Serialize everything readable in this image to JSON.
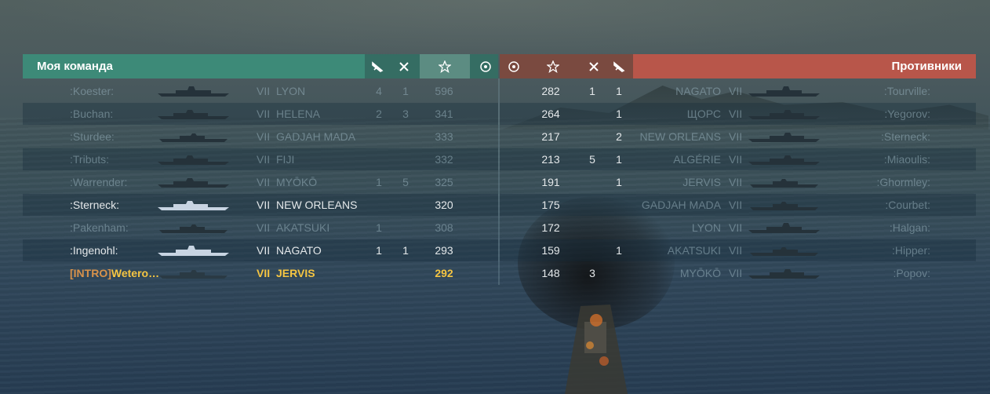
{
  "header": {
    "my_team_title": "Моя команда",
    "enemy_team_title": "Противники",
    "left_icons": [
      "plane-icon",
      "ship-kill-icon",
      "star-icon",
      "laurel-icon"
    ],
    "right_icons": [
      "laurel-icon",
      "star-icon",
      "ship-kill-icon",
      "plane-icon"
    ]
  },
  "colors": {
    "my_team_header": "#3d8a78",
    "enemy_header": "#b8564a",
    "self_highlight": "#f5c542",
    "clan_tag": "#d8924a"
  },
  "my_team": [
    {
      "player": ":Koester:",
      "tier": "VII",
      "ship": "LYON",
      "kills": "4",
      "planes": "1",
      "score": "596",
      "alive": false,
      "ship_icon": "battleship-icon"
    },
    {
      "player": ":Buchan:",
      "tier": "VII",
      "ship": "HELENA",
      "kills": "2",
      "planes": "3",
      "score": "341",
      "alive": false,
      "ship_icon": "cruiser-icon"
    },
    {
      "player": ":Sturdee:",
      "tier": "VII",
      "ship": "GADJAH MADA",
      "kills": "",
      "planes": "",
      "score": "333",
      "alive": false,
      "ship_icon": "destroyer-icon"
    },
    {
      "player": ":Tributs:",
      "tier": "VII",
      "ship": "FIJI",
      "kills": "",
      "planes": "",
      "score": "332",
      "alive": false,
      "ship_icon": "cruiser-icon"
    },
    {
      "player": ":Warrender:",
      "tier": "VII",
      "ship": "MYŌKŌ",
      "kills": "1",
      "planes": "5",
      "score": "325",
      "alive": false,
      "ship_icon": "cruiser-icon"
    },
    {
      "player": ":Sterneck:",
      "tier": "VII",
      "ship": "NEW ORLEANS",
      "kills": "",
      "planes": "",
      "score": "320",
      "alive": true,
      "ship_icon": "cruiser-icon"
    },
    {
      "player": ":Pakenham:",
      "tier": "VII",
      "ship": "AKATSUKI",
      "kills": "1",
      "planes": "",
      "score": "308",
      "alive": false,
      "ship_icon": "destroyer-icon"
    },
    {
      "player": ":Ingenohl:",
      "tier": "VII",
      "ship": "NAGATO",
      "kills": "1",
      "planes": "1",
      "score": "293",
      "alive": true,
      "ship_icon": "battleship-icon"
    },
    {
      "clan": "[INTRO]",
      "player": "Wetero…",
      "tier": "VII",
      "ship": "JERVIS",
      "kills": "",
      "planes": "",
      "score": "292",
      "alive": false,
      "self": true,
      "ship_icon": "destroyer-icon"
    }
  ],
  "enemy_team": [
    {
      "score": "282",
      "planes": "1",
      "kills": "1",
      "ship": "NAGATO",
      "tier": "VII",
      "player": ":Tourville:",
      "ship_icon": "battleship-icon"
    },
    {
      "score": "264",
      "planes": "",
      "kills": "1",
      "ship": "ЩОРС",
      "tier": "VII",
      "player": ":Yegorov:",
      "ship_icon": "cruiser-icon"
    },
    {
      "score": "217",
      "planes": "",
      "kills": "2",
      "ship": "NEW ORLEANS",
      "tier": "VII",
      "player": ":Sterneck:",
      "ship_icon": "cruiser-icon"
    },
    {
      "score": "213",
      "planes": "5",
      "kills": "1",
      "ship": "ALGÉRIE",
      "tier": "VII",
      "player": ":Miaoulis:",
      "ship_icon": "cruiser-icon"
    },
    {
      "score": "191",
      "planes": "",
      "kills": "1",
      "ship": "JERVIS",
      "tier": "VII",
      "player": ":Ghormley:",
      "ship_icon": "destroyer-icon"
    },
    {
      "score": "175",
      "planes": "",
      "kills": "",
      "ship": "GADJAH MADA",
      "tier": "VII",
      "player": ":Courbet:",
      "ship_icon": "destroyer-icon"
    },
    {
      "score": "172",
      "planes": "",
      "kills": "",
      "ship": "LYON",
      "tier": "VII",
      "player": ":Halgan:",
      "ship_icon": "battleship-icon"
    },
    {
      "score": "159",
      "planes": "",
      "kills": "1",
      "ship": "AKATSUKI",
      "tier": "VII",
      "player": ":Hipper:",
      "ship_icon": "destroyer-icon"
    },
    {
      "score": "148",
      "planes": "3",
      "kills": "",
      "ship": "MYŌKŌ",
      "tier": "VII",
      "player": ":Popov:",
      "ship_icon": "cruiser-icon"
    }
  ]
}
